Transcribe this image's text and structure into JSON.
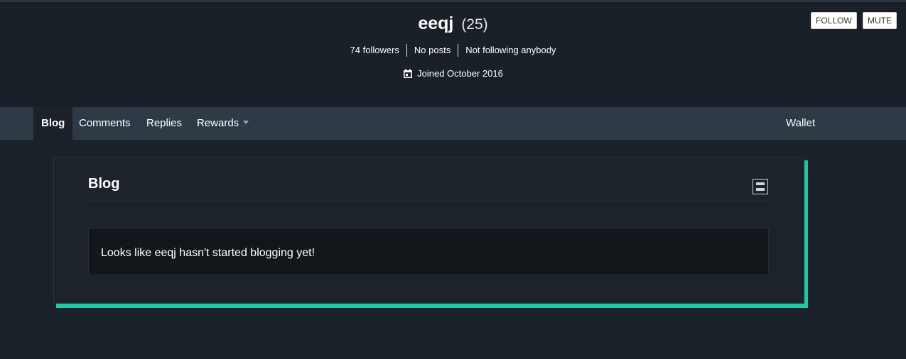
{
  "profile": {
    "username": "eeqj",
    "reputation": "(25)",
    "stats": [
      "74 followers",
      "No posts",
      "Not following anybody"
    ],
    "joined": "Joined October 2016",
    "follow_label": "FOLLOW",
    "mute_label": "MUTE"
  },
  "tabs": {
    "blog": "Blog",
    "comments": "Comments",
    "replies": "Replies",
    "rewards": "Rewards",
    "wallet": "Wallet"
  },
  "card": {
    "title": "Blog",
    "empty_message": "Looks like eeqj hasn't started blogging yet!"
  },
  "colors": {
    "background": "#1b2229",
    "header": "#1a2027",
    "tabbar": "#2e3b47",
    "accent": "#1fc7a5"
  },
  "icons": {
    "joined": "calendar-icon",
    "layout_toggle": "layout-toggle-icon",
    "rewards_dropdown": "chevron-down-icon"
  }
}
